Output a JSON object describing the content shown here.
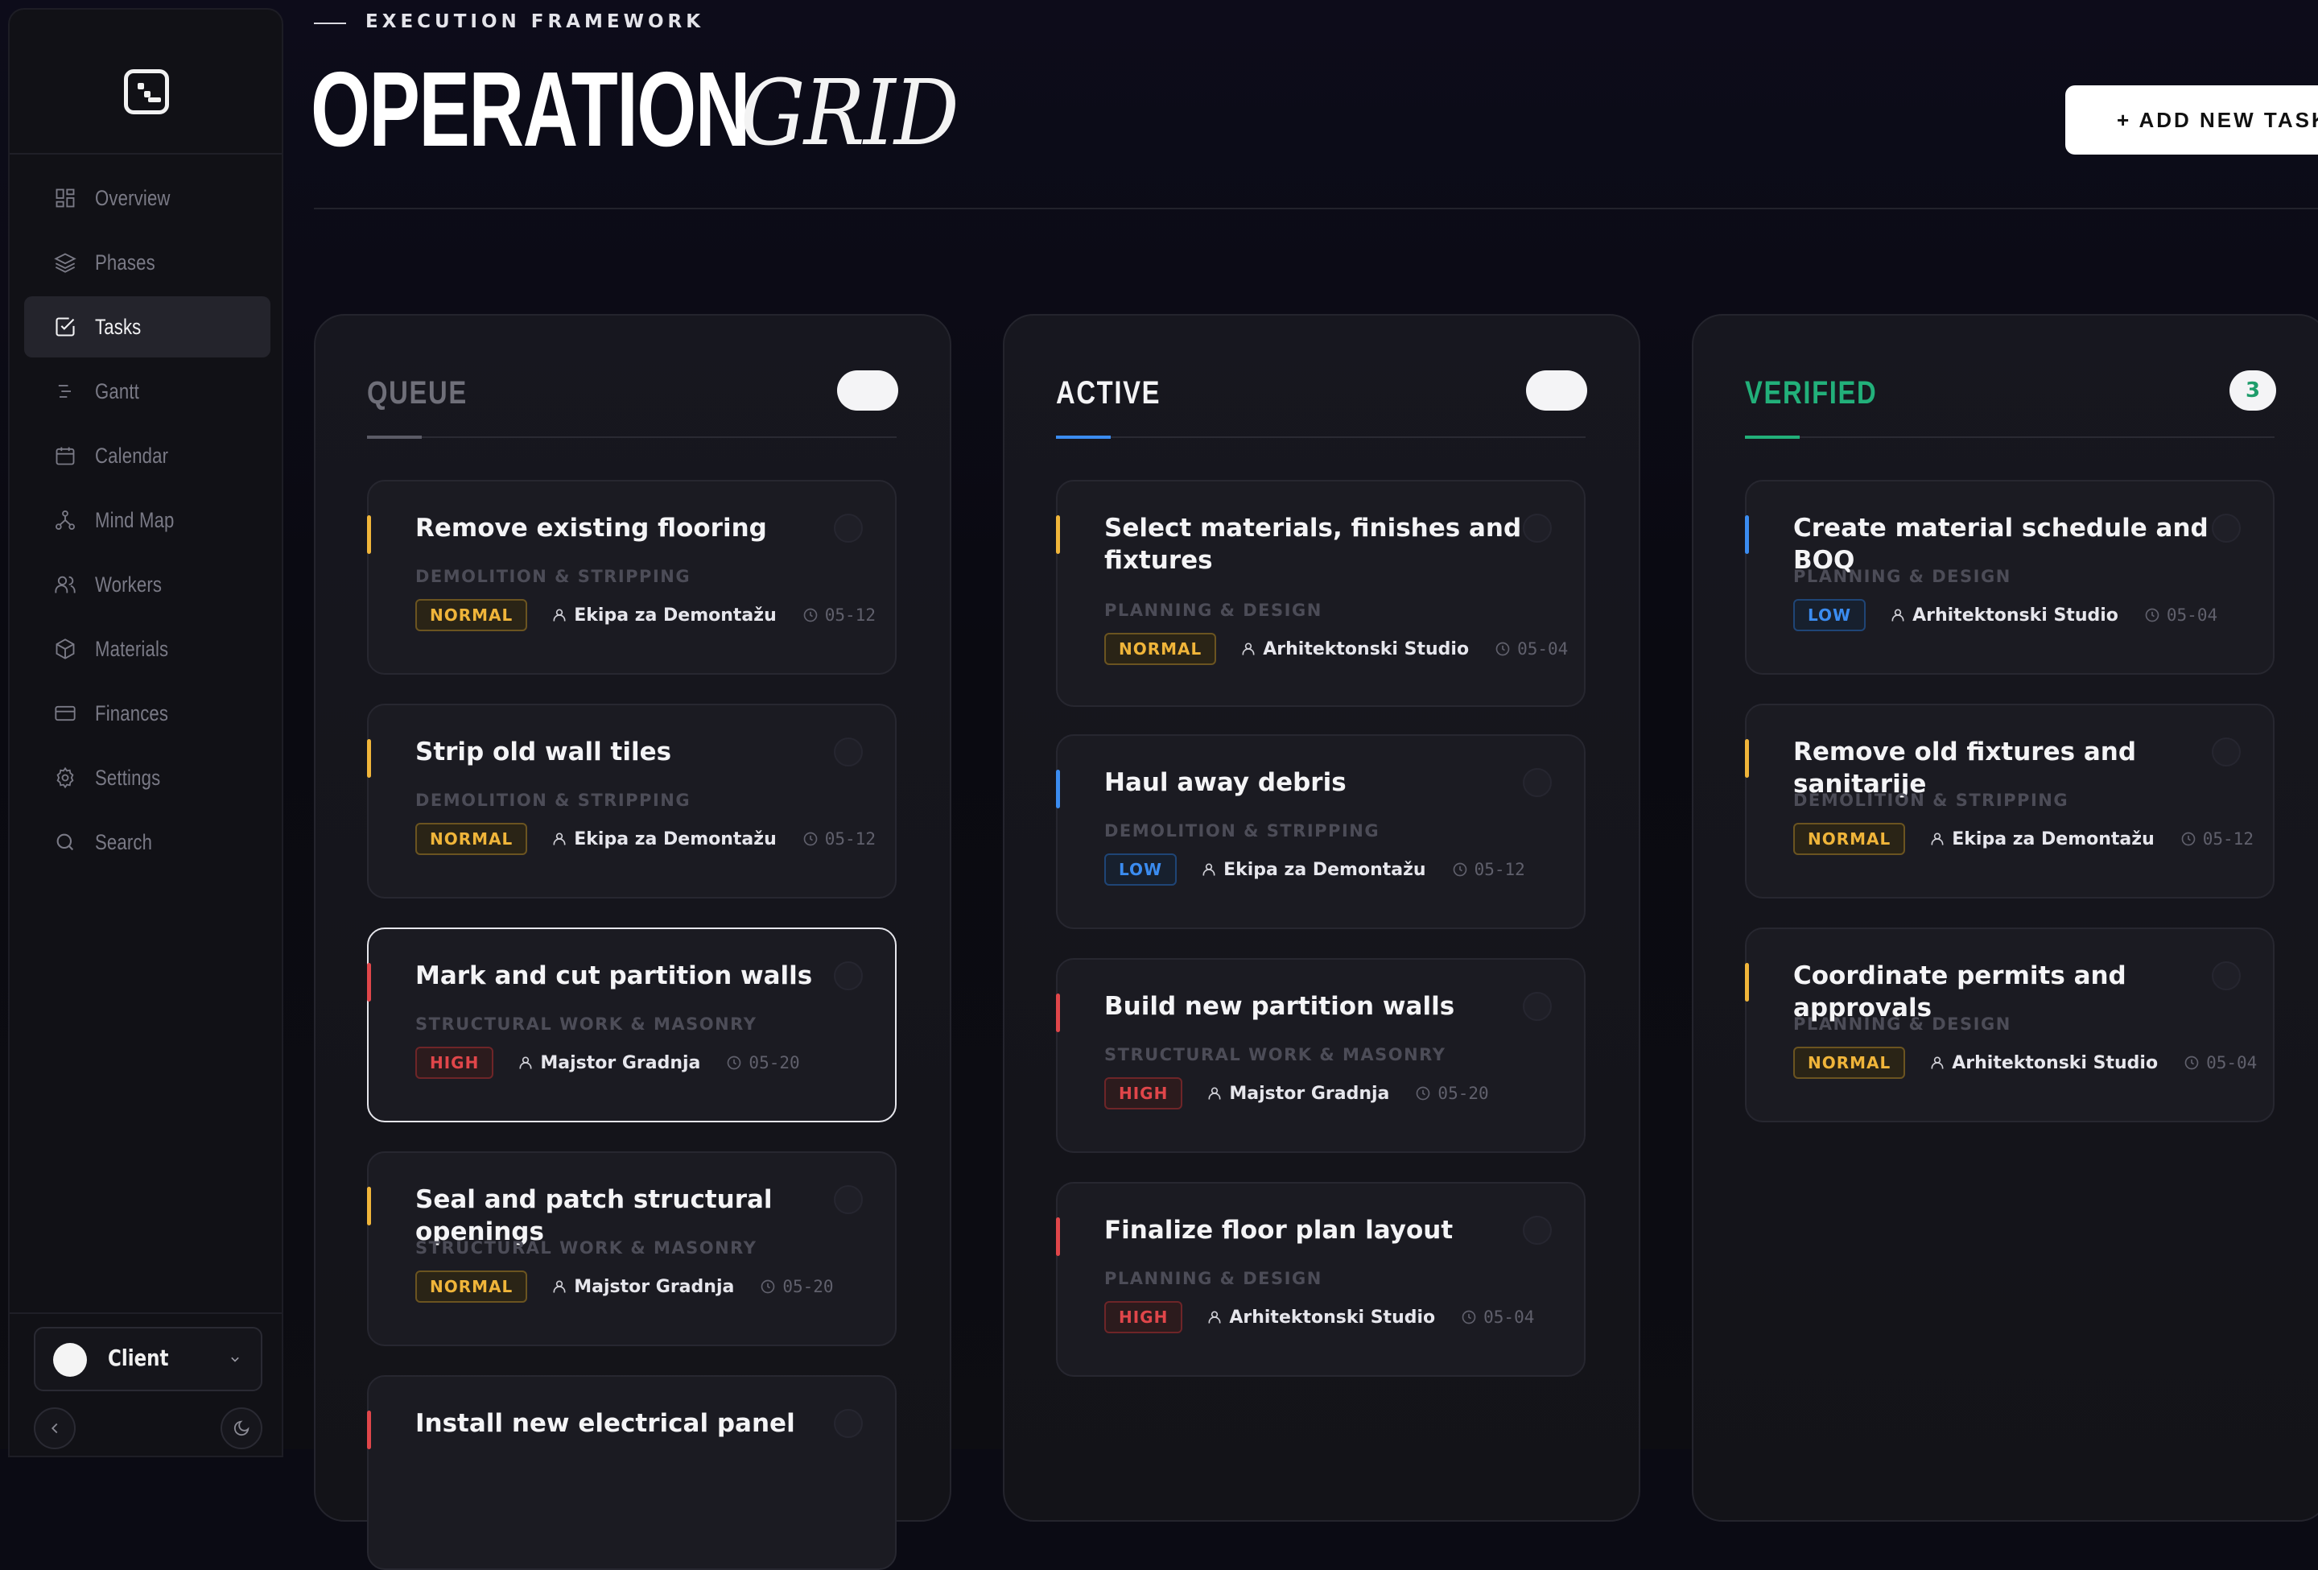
{
  "sidebar": {
    "items": [
      {
        "label": "Overview",
        "icon": "grid-icon"
      },
      {
        "label": "Phases",
        "icon": "layers-icon"
      },
      {
        "label": "Tasks",
        "icon": "checkbox-icon",
        "active": true
      },
      {
        "label": "Gantt",
        "icon": "gantt-icon"
      },
      {
        "label": "Calendar",
        "icon": "calendar-icon"
      },
      {
        "label": "Mind Map",
        "icon": "network-icon"
      },
      {
        "label": "Workers",
        "icon": "users-icon"
      },
      {
        "label": "Materials",
        "icon": "box-icon"
      },
      {
        "label": "Finances",
        "icon": "card-icon"
      },
      {
        "label": "Settings",
        "icon": "gear-icon"
      },
      {
        "label": "Search",
        "icon": "search-icon"
      }
    ],
    "user": {
      "name": "Client"
    }
  },
  "header": {
    "eyebrow": "EXECUTION FRAMEWORK",
    "title_main": "OPERATION",
    "title_italic": "GRID",
    "add_button": "+ ADD NEW TASK"
  },
  "columns": [
    {
      "title": "QUEUE",
      "title_color": "#6f6f79",
      "accent": "#5b5b66",
      "cards": [
        {
          "title": "Remove existing flooring",
          "category": "DEMOLITION & STRIPPING",
          "priority": "NORMAL",
          "assignee": "Ekipa za Demontažu",
          "date": "05-12",
          "accent": "#f0b53a"
        },
        {
          "title": "Strip old wall tiles",
          "category": "DEMOLITION & STRIPPING",
          "priority": "NORMAL",
          "assignee": "Ekipa za Demontažu",
          "date": "05-12",
          "accent": "#f0b53a"
        },
        {
          "title": "Mark and cut partition walls",
          "category": "STRUCTURAL WORK & MASONRY",
          "priority": "HIGH",
          "assignee": "Majstor Gradnja",
          "date": "05-20",
          "accent": "#e0464a",
          "selected": true
        },
        {
          "title": "Seal and patch structural openings",
          "category": "STRUCTURAL WORK & MASONRY",
          "priority": "NORMAL",
          "assignee": "Majstor Gradnja",
          "date": "05-20",
          "accent": "#f0b53a"
        },
        {
          "title": "Install new electrical panel",
          "category": "",
          "priority": "",
          "assignee": "",
          "date": "",
          "accent": "#e0464a"
        }
      ]
    },
    {
      "title": "ACTIVE",
      "title_color": "#f4f4f6",
      "accent": "#3b8cf0",
      "cards": [
        {
          "title": "Select materials, finishes and fixtures",
          "category": "PLANNING & DESIGN",
          "priority": "NORMAL",
          "assignee": "Arhitektonski Studio",
          "date": "05-04",
          "accent": "#f0b53a"
        },
        {
          "title": "Haul away debris",
          "category": "DEMOLITION & STRIPPING",
          "priority": "LOW",
          "assignee": "Ekipa za Demontažu",
          "date": "05-12",
          "accent": "#3b8cf0"
        },
        {
          "title": "Build new partition walls",
          "category": "STRUCTURAL WORK & MASONRY",
          "priority": "HIGH",
          "assignee": "Majstor Gradnja",
          "date": "05-20",
          "accent": "#e0464a"
        },
        {
          "title": "Finalize floor plan layout",
          "category": "PLANNING & DESIGN",
          "priority": "HIGH",
          "assignee": "Arhitektonski Studio",
          "date": "05-04",
          "accent": "#e0464a"
        }
      ]
    },
    {
      "title": "VERIFIED",
      "title_color": "#22b07a",
      "accent": "#22b07a",
      "badge": "3",
      "cards": [
        {
          "title": "Create material schedule and BOQ",
          "category": "PLANNING & DESIGN",
          "priority": "LOW",
          "assignee": "Arhitektonski Studio",
          "date": "05-04",
          "accent": "#3b8cf0"
        },
        {
          "title": "Remove old fixtures and sanitarije",
          "category": "DEMOLITION & STRIPPING",
          "priority": "NORMAL",
          "assignee": "Ekipa za Demontažu",
          "date": "05-12",
          "accent": "#f0b53a"
        },
        {
          "title": "Coordinate permits and approvals",
          "category": "PLANNING & DESIGN",
          "priority": "NORMAL",
          "assignee": "Arhitektonski Studio",
          "date": "05-04",
          "accent": "#f0b53a"
        }
      ]
    }
  ]
}
